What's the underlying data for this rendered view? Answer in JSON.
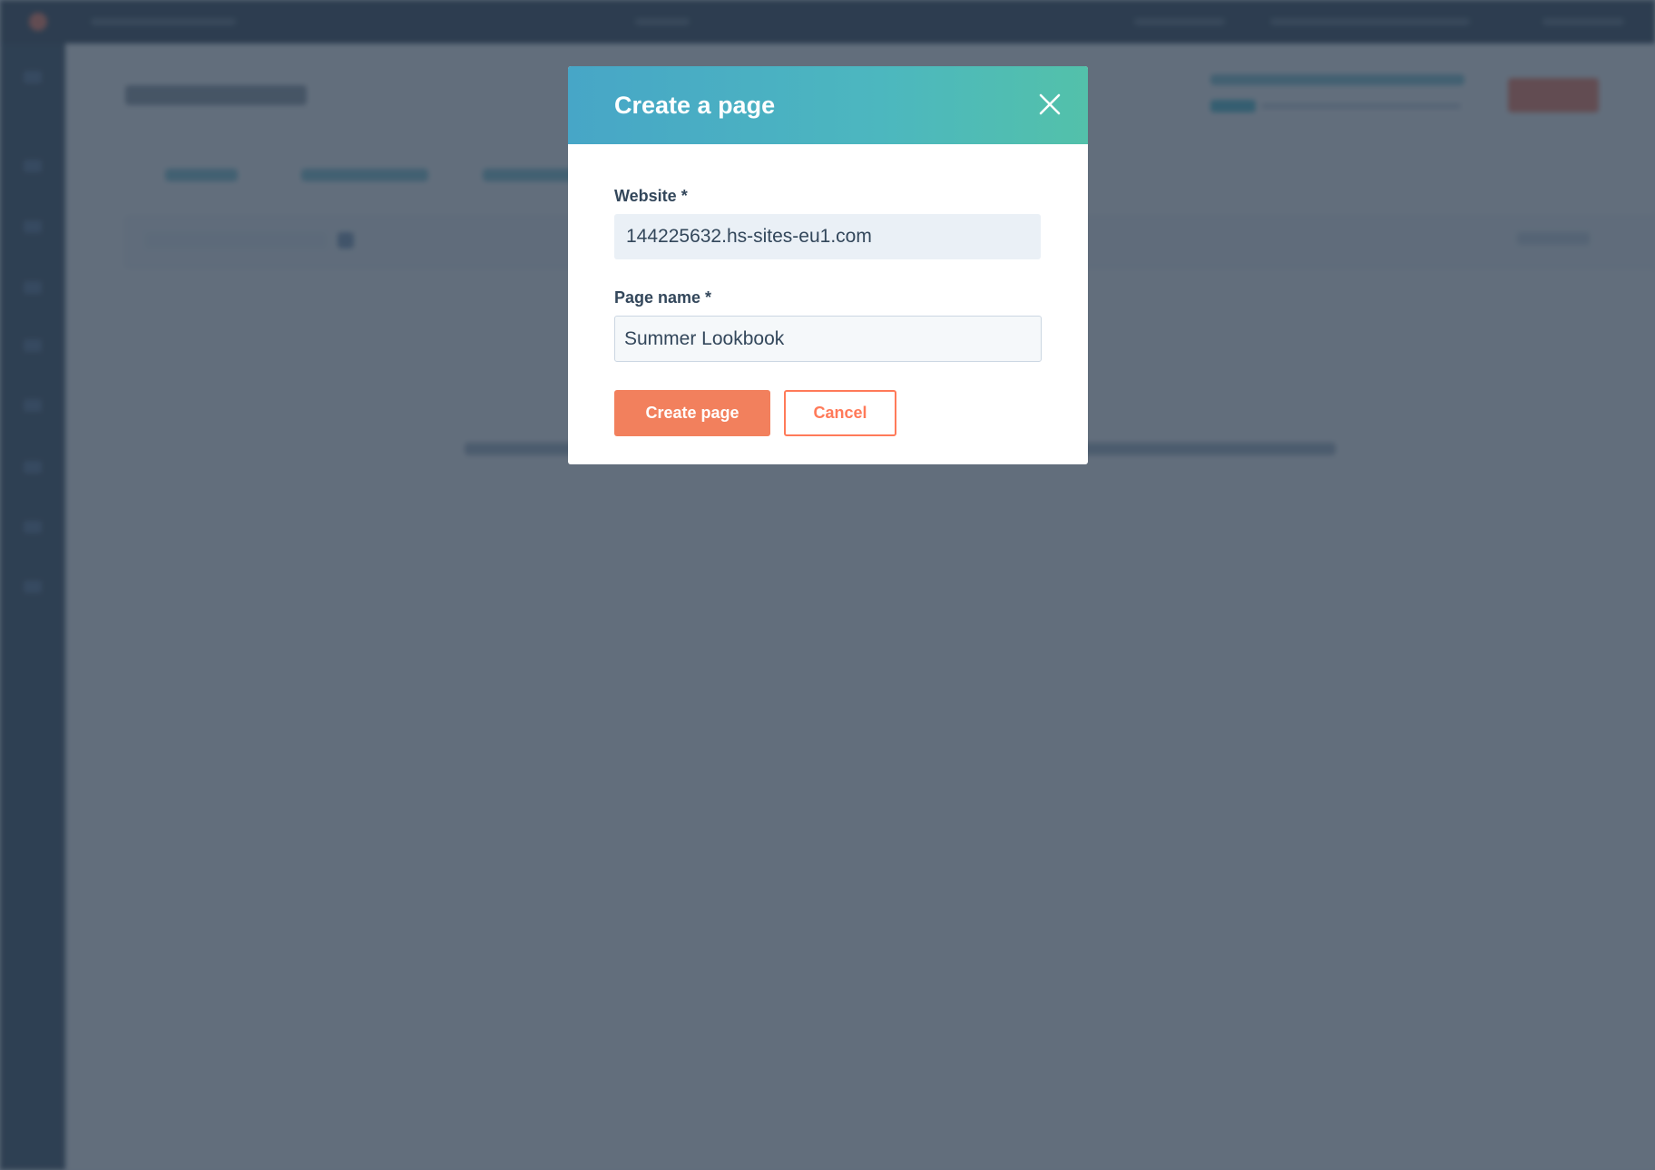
{
  "modal": {
    "title": "Create a page",
    "website_label": "Website *",
    "website_value": "144225632.hs-sites-eu1.com",
    "page_name_label": "Page name *",
    "page_name_value": "Summer Lookbook",
    "create_label": "Create page",
    "cancel_label": "Cancel"
  },
  "colors": {
    "overlay": "#2d3e50",
    "header_gradient_start": "#47a6c7",
    "header_gradient_end": "#53c1aa",
    "primary": "#f2805d",
    "secondary_border": "#ff7a59"
  },
  "icons": {
    "close": "close-icon"
  }
}
